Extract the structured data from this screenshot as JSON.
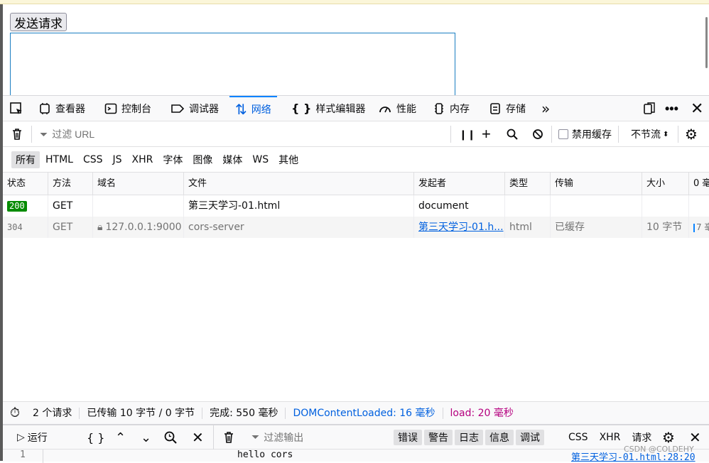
{
  "page": {
    "send_button": "发送请求"
  },
  "devtools": {
    "tabs": [
      {
        "label": "查看器",
        "icon": "inspector-icon"
      },
      {
        "label": "控制台",
        "icon": "console-icon"
      },
      {
        "label": "调试器",
        "icon": "debugger-icon"
      },
      {
        "label": "网络",
        "icon": "network-icon",
        "active": true
      },
      {
        "label": "样式编辑器",
        "icon": "style-editor-icon"
      },
      {
        "label": "性能",
        "icon": "performance-icon"
      },
      {
        "label": "内存",
        "icon": "memory-icon"
      },
      {
        "label": "存储",
        "icon": "storage-icon"
      }
    ],
    "filter": {
      "placeholder": "过滤 URL",
      "disable_cache": "禁用缓存",
      "throttle": "不节流"
    },
    "types": [
      "所有",
      "HTML",
      "CSS",
      "JS",
      "XHR",
      "字体",
      "图像",
      "媒体",
      "WS",
      "其他"
    ],
    "columns": [
      "状态",
      "方法",
      "域名",
      "文件",
      "发起者",
      "类型",
      "传输",
      "大小",
      "0 毫"
    ],
    "rows": [
      {
        "status": "200",
        "method": "GET",
        "domain": "",
        "file": "第三天学习-01.html",
        "initiator": "document",
        "type": "",
        "transfer": "",
        "size": ""
      },
      {
        "status": "304",
        "method": "GET",
        "domain": "127.0.0.1:9000",
        "file": "cors-server",
        "initiator": "第三天学习-01.h...",
        "type": "html",
        "transfer": "已缓存",
        "size": "10 字节",
        "timing": "7 毫"
      }
    ],
    "summary": {
      "requests": "2 个请求",
      "transferred": "已传输 10 字节 / 0 字节",
      "finish": "完成: 550 毫秒",
      "dcl": "DOMContentLoaded: 16 毫秒",
      "load": "load: 20 毫秒"
    },
    "console": {
      "run": "运行",
      "filter_placeholder": "过滤输出",
      "chips": [
        "错误",
        "警告",
        "日志",
        "信息",
        "调试"
      ],
      "plain": [
        "CSS",
        "XHR",
        "请求"
      ],
      "line_number": "1",
      "log_message": "hello cors",
      "log_source": "第三天学习-01.html:28:20"
    }
  },
  "watermark": "CSDN @COLDEHY"
}
